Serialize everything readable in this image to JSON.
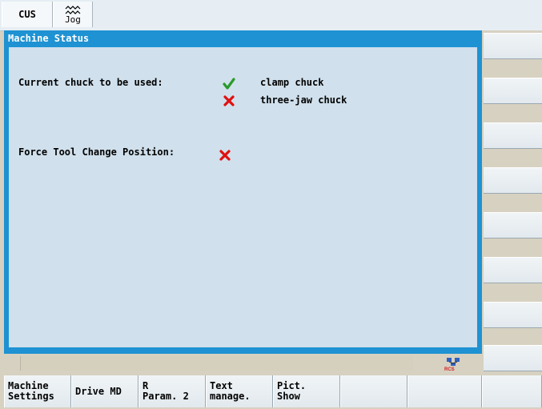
{
  "header": {
    "mode_label": "CUS",
    "jog_label": "Jog",
    "jog_icon": "jog-wave-icon"
  },
  "window": {
    "title": "Machine Status",
    "chuck_label": "Current chuck to be used:",
    "chuck_options": [
      {
        "label": "clamp chuck",
        "state": "check"
      },
      {
        "label": "three-jaw chuck",
        "state": "cross"
      }
    ],
    "force_label": "Force Tool Change Position:",
    "force_state": "cross"
  },
  "status": {
    "rcs_icon": "rcs-network-icon"
  },
  "softkeys_h": [
    {
      "line1": "Machine",
      "line2": "Settings"
    },
    {
      "line1": "Drive MD",
      "line2": ""
    },
    {
      "line1": "R",
      "line2": "Param. 2"
    },
    {
      "line1": "Text",
      "line2": "manage."
    },
    {
      "line1": "Pict.",
      "line2": "Show"
    },
    {
      "line1": "",
      "line2": ""
    },
    {
      "line1": "",
      "line2": ""
    },
    {
      "line1": "",
      "line2": ""
    }
  ],
  "colors": {
    "check": "#2a9a2a",
    "cross": "#e01010",
    "window_frame": "#1e92d2",
    "window_bg": "#d0e0ec"
  }
}
